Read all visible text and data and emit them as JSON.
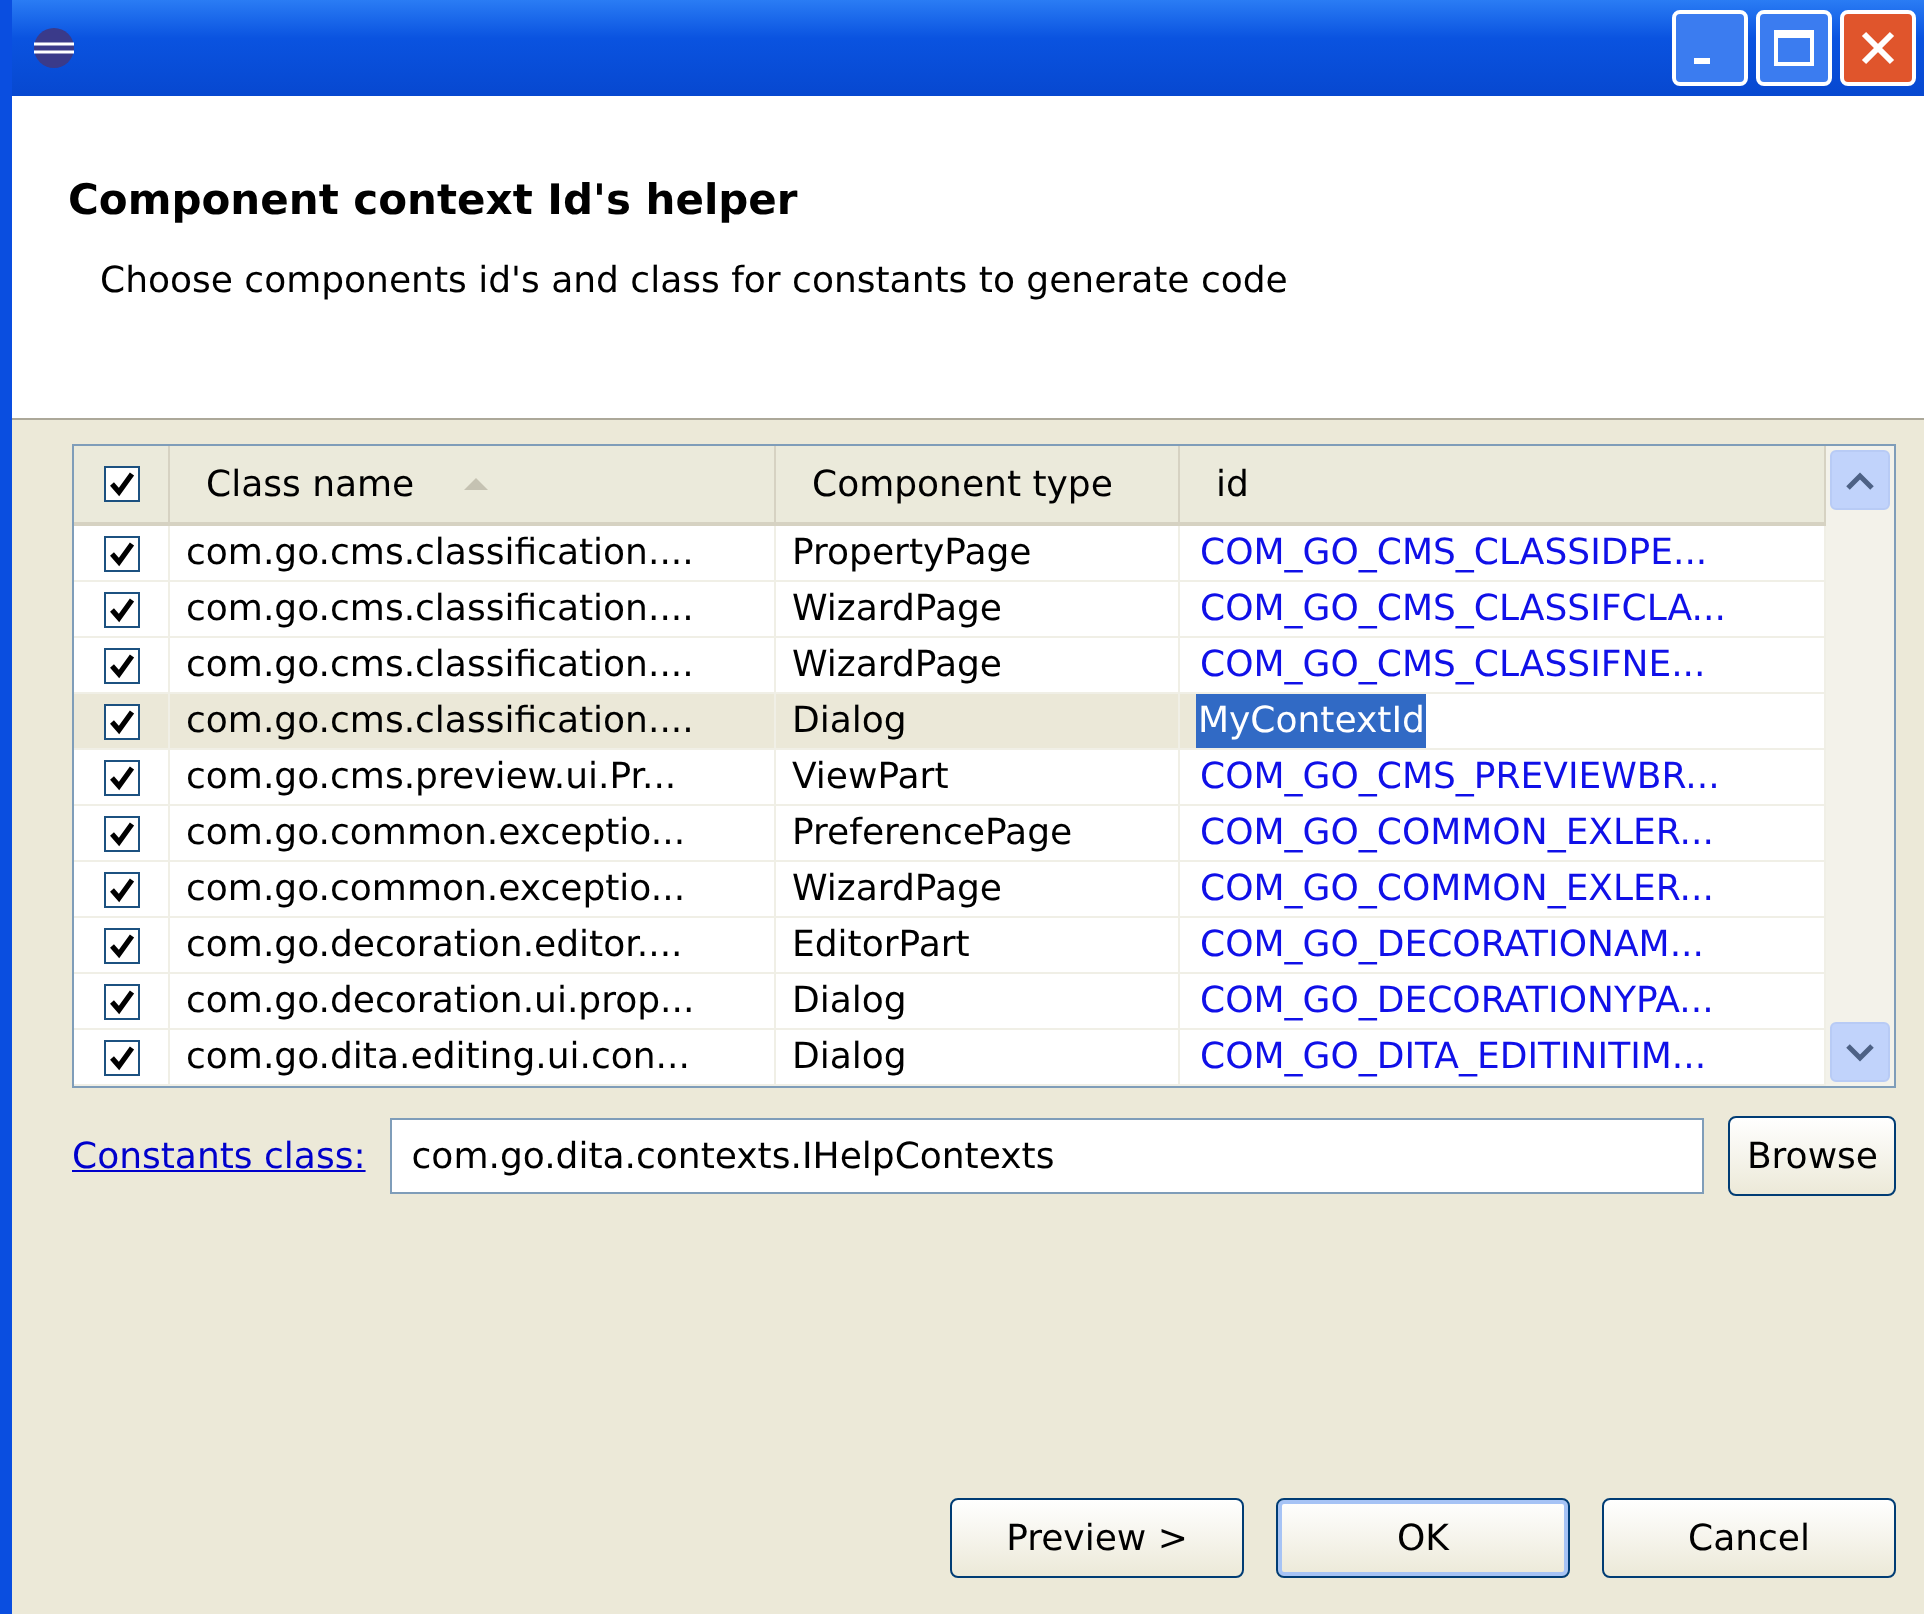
{
  "header": {
    "title": "Component context Id's helper",
    "description": "Choose components id's and class for constants to generate code"
  },
  "table": {
    "all_checked": true,
    "columns": [
      {
        "label": "Class name",
        "sorted": true
      },
      {
        "label": "Component type",
        "sorted": false
      },
      {
        "label": "id",
        "sorted": false
      }
    ],
    "rows": [
      {
        "checked": true,
        "selected": false,
        "editing": false,
        "class_name": "com.go.cms.classification....",
        "type": "PropertyPage",
        "id": "COM_GO_CMS_CLASSIDPE..."
      },
      {
        "checked": true,
        "selected": false,
        "editing": false,
        "class_name": "com.go.cms.classification....",
        "type": "WizardPage",
        "id": "COM_GO_CMS_CLASSIFCLA..."
      },
      {
        "checked": true,
        "selected": false,
        "editing": false,
        "class_name": "com.go.cms.classification....",
        "type": "WizardPage",
        "id": "COM_GO_CMS_CLASSIFNE..."
      },
      {
        "checked": true,
        "selected": true,
        "editing": true,
        "class_name": "com.go.cms.classification....",
        "type": "Dialog",
        "id": "MyContextId"
      },
      {
        "checked": true,
        "selected": false,
        "editing": false,
        "class_name": "com.go.cms.preview.ui.Pr...",
        "type": "ViewPart",
        "id": "COM_GO_CMS_PREVIEWBR..."
      },
      {
        "checked": true,
        "selected": false,
        "editing": false,
        "class_name": "com.go.common.exceptio...",
        "type": "PreferencePage",
        "id": "COM_GO_COMMON_EXLER..."
      },
      {
        "checked": true,
        "selected": false,
        "editing": false,
        "class_name": "com.go.common.exceptio...",
        "type": "WizardPage",
        "id": "COM_GO_COMMON_EXLER..."
      },
      {
        "checked": true,
        "selected": false,
        "editing": false,
        "class_name": "com.go.decoration.editor....",
        "type": "EditorPart",
        "id": "COM_GO_DECORATIONAM..."
      },
      {
        "checked": true,
        "selected": false,
        "editing": false,
        "class_name": "com.go.decoration.ui.prop...",
        "type": "Dialog",
        "id": "COM_GO_DECORATIONYPA..."
      },
      {
        "checked": true,
        "selected": false,
        "editing": false,
        "class_name": "com.go.dita.editing.ui.con...",
        "type": "Dialog",
        "id": "COM_GO_DITA_EDITINITIM..."
      }
    ]
  },
  "constants": {
    "label": "Constants class:",
    "value": "com.go.dita.contexts.IHelpContexts",
    "button": "Browse"
  },
  "buttons": [
    {
      "label": "Preview >",
      "default": false
    },
    {
      "label": "OK",
      "default": true
    },
    {
      "label": "Cancel",
      "default": false
    }
  ]
}
